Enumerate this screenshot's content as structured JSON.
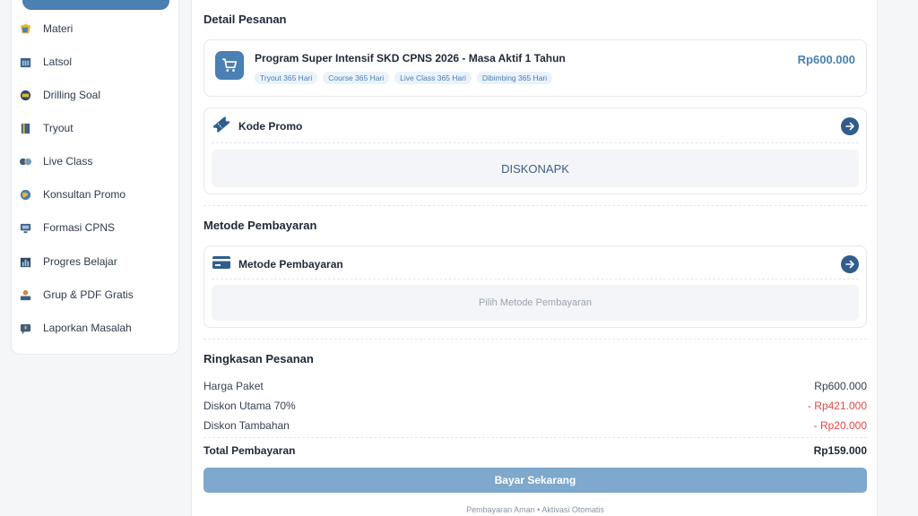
{
  "sidebar": {
    "items": [
      {
        "label": "Materi",
        "icon": "book-icon"
      },
      {
        "label": "Latsol",
        "icon": "calendar-icon"
      },
      {
        "label": "Drilling Soal",
        "icon": "drill-icon"
      },
      {
        "label": "Tryout",
        "icon": "notebook-icon"
      },
      {
        "label": "Live Class",
        "icon": "live-icon"
      },
      {
        "label": "Konsultan Promo",
        "icon": "globe-icon"
      },
      {
        "label": "Formasi CPNS",
        "icon": "monitor-icon"
      },
      {
        "label": "Progres Belajar",
        "icon": "chart-icon"
      },
      {
        "label": "Grup & PDF Gratis",
        "icon": "group-icon"
      },
      {
        "label": "Laporkan Masalah",
        "icon": "report-icon"
      }
    ]
  },
  "order": {
    "title": "Detail Pesanan",
    "product": {
      "name": "Program Super Intensif SKD CPNS 2026 - Masa Aktif 1 Tahun",
      "price": "Rp600.000",
      "tags": [
        "Tryout 365 Hari",
        "Course 365 Hari",
        "Live Class 365 Hari",
        "Dibimbing 365 Hari"
      ]
    },
    "promo": {
      "label": "Kode Promo",
      "value": "DISKONAPK"
    }
  },
  "payment": {
    "title": "Metode Pembayaran",
    "label": "Metode Pembayaran",
    "placeholder": "Pilih Metode Pembayaran"
  },
  "summary": {
    "title": "Ringkasan Pesanan",
    "rows": [
      {
        "label": "Harga Paket",
        "value": "Rp600.000"
      },
      {
        "label": "Diskon Utama 70%",
        "value": "- Rp421.000"
      },
      {
        "label": "Diskon Tambahan",
        "value": "- Rp20.000"
      }
    ],
    "total_label": "Total Pembayaran",
    "total_value": "Rp159.000",
    "pay_button": "Bayar Sekarang",
    "footer": "Pembayaran Aman  •  Aktivasi Otomatis"
  },
  "colors": {
    "accent": "#4a80b3",
    "button": "#7ea8cc",
    "discount": "#e04848"
  }
}
